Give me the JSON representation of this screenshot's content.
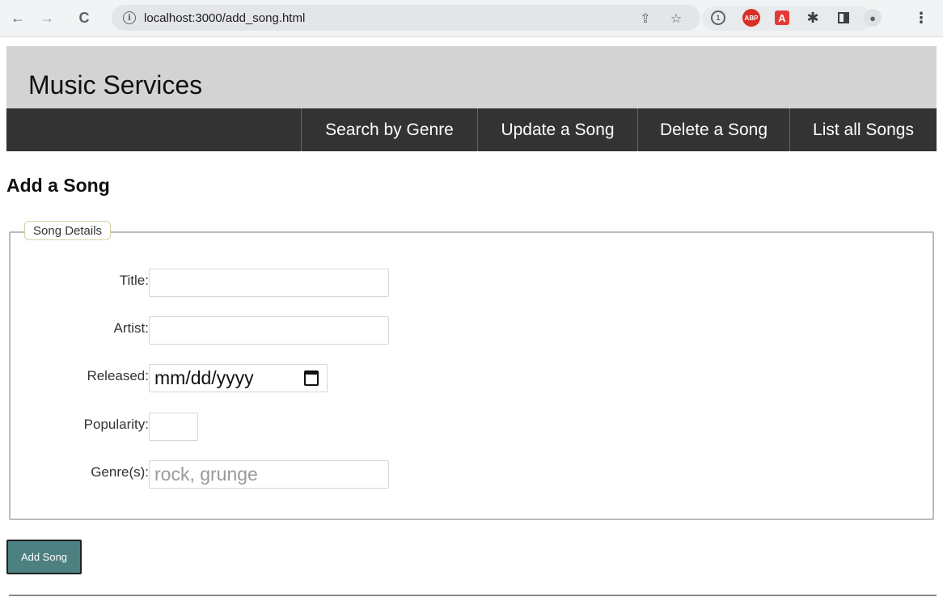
{
  "browser": {
    "url": "localhost:3000/add_song.html",
    "back_icon": "←",
    "forward_icon": "→",
    "reload_icon": "C",
    "info_icon": "i",
    "share_icon": "⇪",
    "star_icon": "☆",
    "ext_1p_icon": "1",
    "ext_abp_label": "ABP",
    "ext_pdf_label": "A",
    "puzzle_icon": "✱",
    "profile_icon": "●",
    "menu_icon": "⋮"
  },
  "header": {
    "title": "Music Services"
  },
  "nav": {
    "items": [
      {
        "label": "Search by Genre"
      },
      {
        "label": "Update a Song"
      },
      {
        "label": "Delete a Song"
      },
      {
        "label": "List all Songs"
      }
    ]
  },
  "main": {
    "title": "Add a Song",
    "fieldset_legend": "Song Details",
    "fields": {
      "title": {
        "label": "Title:",
        "value": ""
      },
      "artist": {
        "label": "Artist:",
        "value": ""
      },
      "released": {
        "label": "Released:",
        "value": "mm/dd/yyyy"
      },
      "popularity": {
        "label": "Popularity:",
        "value": ""
      },
      "genres": {
        "label": "Genre(s):",
        "placeholder": "rock, grunge"
      }
    },
    "submit_label": "Add Song"
  },
  "colors": {
    "header_bg": "#d3d3d3",
    "navbar_bg": "#333333",
    "button_bg": "#4d8080"
  }
}
